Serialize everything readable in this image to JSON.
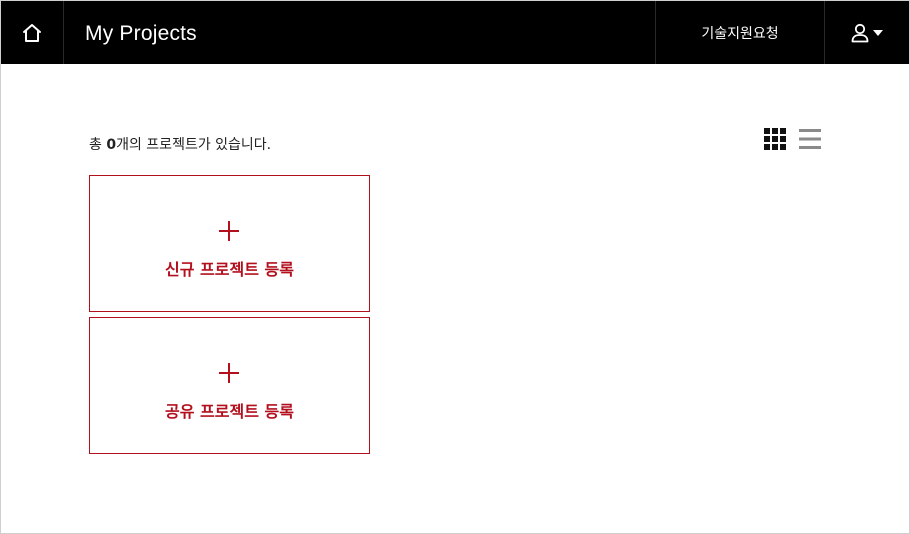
{
  "header": {
    "app_title": "My Projects",
    "support_label": "기술지원요청",
    "icons": {
      "home": "home-icon",
      "user": "user-icon",
      "dropdown": "caret-down-icon"
    }
  },
  "summary": {
    "prefix": "총 ",
    "count": "0",
    "suffix": "개의 프로젝트가 있습니다."
  },
  "view_modes": {
    "grid": "grid-view-icon",
    "list": "list-view-icon",
    "active": "grid"
  },
  "cards": [
    {
      "label": "신규 프로젝트 등록",
      "icon": "plus-icon"
    },
    {
      "label": "공유 프로젝트 등록",
      "icon": "plus-icon"
    }
  ],
  "colors": {
    "accent": "#b3101e",
    "header_bg": "#000000",
    "header_text": "#ffffff",
    "inactive_icon": "#8a8a8a"
  }
}
